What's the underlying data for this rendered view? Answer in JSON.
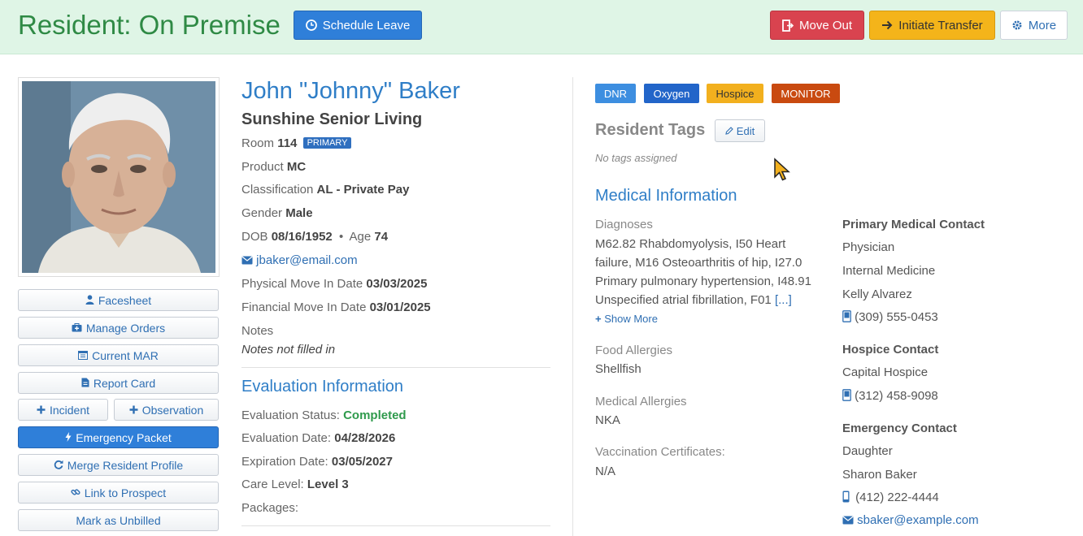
{
  "header": {
    "title": "Resident: On Premise",
    "schedule_leave": "Schedule Leave",
    "move_out": "Move Out",
    "initiate_transfer": "Initiate Transfer",
    "more": "More"
  },
  "sidebar": {
    "facesheet": "Facesheet",
    "manage_orders": "Manage Orders",
    "current_mar": "Current MAR",
    "report_card": "Report Card",
    "incident": "Incident",
    "observation": "Observation",
    "emergency_packet": "Emergency Packet",
    "merge_profile": "Merge Resident Profile",
    "link_prospect": "Link to Prospect",
    "mark_unbilled": "Mark as Unbilled"
  },
  "resident": {
    "name": "John \"Johnny\" Baker",
    "community": "Sunshine Senior Living",
    "room_label": "Room",
    "room": "114",
    "room_badge": "PRIMARY",
    "product_label": "Product",
    "product": "MC",
    "classification_label": "Classification",
    "classification": "AL - Private Pay",
    "gender_label": "Gender",
    "gender": "Male",
    "dob_label": "DOB",
    "dob": "08/16/1952",
    "age_label": "Age",
    "age": "74",
    "email": "jbaker@email.com",
    "physical_move_in_label": "Physical Move In Date",
    "physical_move_in": "03/03/2025",
    "financial_move_in_label": "Financial Move In Date",
    "financial_move_in": "03/01/2025",
    "notes_label": "Notes",
    "notes": "Notes not filled in"
  },
  "evaluation": {
    "title": "Evaluation Information",
    "status_label": "Evaluation Status:",
    "status": "Completed",
    "date_label": "Evaluation Date:",
    "date": "04/28/2026",
    "expiration_label": "Expiration Date:",
    "expiration": "03/05/2027",
    "care_level_label": "Care Level:",
    "care_level": "Level 3",
    "packages_label": "Packages:"
  },
  "tags": {
    "badges": [
      {
        "label": "DNR",
        "bg": "#3d8ee0",
        "fg": "#ffffff"
      },
      {
        "label": "Oxygen",
        "bg": "#2265c9",
        "fg": "#ffffff"
      },
      {
        "label": "Hospice",
        "bg": "#f2b01e",
        "fg": "#333333"
      },
      {
        "label": "MONITOR",
        "bg": "#c94a10",
        "fg": "#ffffff"
      }
    ],
    "title": "Resident Tags",
    "edit": "Edit",
    "empty": "No tags assigned"
  },
  "medical": {
    "title": "Medical Information",
    "diagnoses_label": "Diagnoses",
    "diagnoses": "M62.82 Rhabdomyolysis, I50 Heart failure, M16 Osteoarthritis of hip, I27.0 Primary pulmonary hypertension, I48.91 Unspecified atrial fibrillation, F01",
    "diagnoses_more_marker": "[...]",
    "show_more": "Show More",
    "food_allergies_label": "Food Allergies",
    "food_allergies": "Shellfish",
    "medical_allergies_label": "Medical Allergies",
    "medical_allergies": "NKA",
    "vaccination_label": "Vaccination Certificates:",
    "vaccination": "N/A"
  },
  "contacts": {
    "primary_title": "Primary Medical Contact",
    "primary_role": "Physician",
    "primary_specialty": "Internal Medicine",
    "primary_name": "Kelly Alvarez",
    "primary_phone": "(309) 555-0453",
    "hospice_title": "Hospice Contact",
    "hospice_name": "Capital Hospice",
    "hospice_phone": "(312) 458-9098",
    "emergency_title": "Emergency Contact",
    "emergency_relation": "Daughter",
    "emergency_name": "Sharon Baker",
    "emergency_phone": "(412) 222-4444",
    "emergency_email": "sbaker@example.com"
  }
}
